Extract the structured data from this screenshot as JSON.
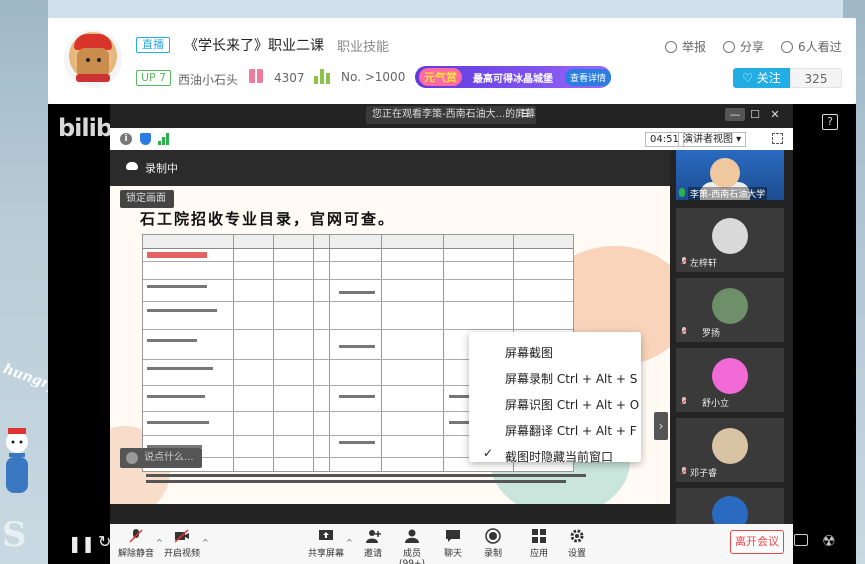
{
  "header": {
    "live_tag": "直播",
    "title": "《学长来了》职业二课",
    "subcategory": "职业技能",
    "up_level": "UP 7",
    "streamer": "西油小石头",
    "gift_count": "4307",
    "rank": "No. >1000",
    "banner": {
      "logo": "元气赏",
      "text": "最高可得冰晶城堡",
      "button": "查看详情"
    },
    "actions": {
      "report": "举报",
      "share": "分享",
      "viewers": "6人看过"
    },
    "follow_label": "关注",
    "follow_count": "325"
  },
  "player": {
    "logo": "bilibili",
    "help": "?"
  },
  "meeting": {
    "notify": "您正在观看李策-西南石油大...的屏幕",
    "timer": "04:51",
    "view_mode": "演讲者视图 ▾",
    "recording": "录制中",
    "lock_screen": "锁定画面",
    "speech_hint": "说点什么...",
    "slide_title": "石工院招收专业目录，官网可查。",
    "context_menu": [
      "屏幕截图",
      "屏幕录制 Ctrl + Alt + S",
      "屏幕识图 Ctrl + Alt + O",
      "屏幕翻译 Ctrl + Alt + F",
      "截图时隐藏当前窗口"
    ],
    "context_checked_index": 4,
    "participants": [
      {
        "name": "李策-西南石油大学",
        "color": "#2a6ac0"
      },
      {
        "name": "左梓轩",
        "color": "#d9d9d9"
      },
      {
        "name": "罗扬",
        "color": "#6f8f6a"
      },
      {
        "name": "舒小立",
        "color": "#f26ad8"
      },
      {
        "name": "邓子睿",
        "color": "#d8c3a5"
      },
      {
        "name": "",
        "color": "#2a6ac0"
      }
    ]
  },
  "toolbar": {
    "unmute": "解除静音",
    "video": "开启视频",
    "share": "共享屏幕",
    "invite": "邀请",
    "members": "成员(99+)",
    "chat": "聊天",
    "record": "录制",
    "apps": "应用",
    "settings": "设置",
    "leave": "离开会议"
  },
  "background": {
    "snow_text": "hungry",
    "snow_letter": "S"
  },
  "colors": {
    "accent": "#23ade5",
    "leave": "#e44444"
  }
}
